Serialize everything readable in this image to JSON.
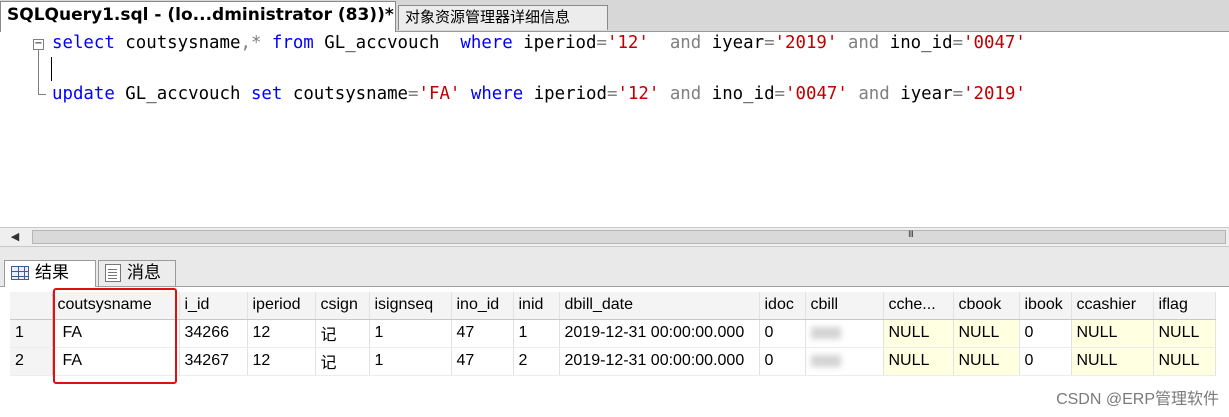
{
  "doc_tabs": [
    {
      "label": "SQLQuery1.sql - (lo...dministrator (83))*",
      "active": true
    },
    {
      "label": "对象资源管理器详细信息",
      "active": false
    }
  ],
  "editor": {
    "line1": {
      "t1": "select",
      "t2": " coutsysname",
      "t3": ",*",
      "t4": " from",
      "t5": " GL_accvouch  ",
      "t6": "where",
      "t7": " iperiod",
      "t8": "=",
      "t9": "'12'",
      "t10": "  and",
      "t11": " iyear",
      "t12": "=",
      "t13": "'2019'",
      "t14": " and",
      "t15": " ino_id",
      "t16": "=",
      "t17": "'0047'"
    },
    "line3": {
      "t1": "update",
      "t2": " GL_accvouch ",
      "t3": "set",
      "t4": " coutsysname",
      "t5": "=",
      "t6": "'FA'",
      "t7": " where",
      "t8": " iperiod",
      "t9": "=",
      "t10": "'12'",
      "t11": " and",
      "t12": " ino_id",
      "t13": "=",
      "t14": "'0047'",
      "t15": " and",
      "t16": " iyear",
      "t17": "=",
      "t18": "'2019'"
    }
  },
  "result_tabs": [
    {
      "label": "结果",
      "icon": "grid-icon"
    },
    {
      "label": "消息",
      "icon": "message-icon"
    }
  ],
  "grid": {
    "columns": [
      "coutsysname",
      "i_id",
      "iperiod",
      "csign",
      "isignseq",
      "ino_id",
      "inid",
      "dbill_date",
      "idoc",
      "cbill",
      "cche...",
      "cbook",
      "ibook",
      "ccashier",
      "iflag"
    ],
    "rows": [
      {
        "num": "1",
        "cells": [
          "FA",
          "34266",
          "12",
          "记",
          "1",
          "47",
          "1",
          "2019-12-31 00:00:00.000",
          "0",
          "",
          "NULL",
          "NULL",
          "0",
          "NULL",
          "NULL"
        ]
      },
      {
        "num": "2",
        "cells": [
          "FA",
          "34267",
          "12",
          "记",
          "1",
          "47",
          "2",
          "2019-12-31 00:00:00.000",
          "0",
          "",
          "NULL",
          "NULL",
          "0",
          "NULL",
          "NULL"
        ]
      }
    ]
  },
  "scrollbar_grip": "III",
  "watermark": "CSDN @ERP管理软件",
  "colors": {
    "keyword": "#0000ff",
    "string": "#c00000",
    "null_cell": "#ffffe1",
    "highlight": "#e01010"
  }
}
